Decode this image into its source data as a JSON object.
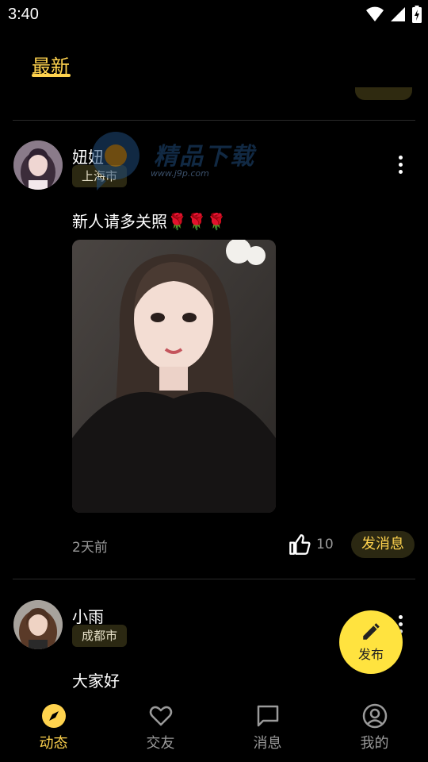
{
  "status_bar": {
    "time": "3:40"
  },
  "top_tabs": [
    {
      "label": "最新",
      "active": true
    }
  ],
  "posts": [
    {
      "username": "妞妞",
      "city": "上海市",
      "text": "新人请多关照🌹🌹🌹",
      "time": "2天前",
      "likes": "10",
      "message_label": "发消息"
    },
    {
      "username": "小雨",
      "city": "成都市",
      "text": "大家好"
    }
  ],
  "watermark": {
    "main": "精品下载",
    "sub": "www.j9p.com"
  },
  "fab": {
    "label": "发布",
    "icon": "pencil-icon"
  },
  "bottom_nav": [
    {
      "label": "动态",
      "icon": "compass-icon",
      "active": true
    },
    {
      "label": "交友",
      "icon": "heart-icon",
      "active": false
    },
    {
      "label": "消息",
      "icon": "chat-icon",
      "active": false
    },
    {
      "label": "我的",
      "icon": "profile-icon",
      "active": false
    }
  ],
  "colors": {
    "accent": "#ffd34e",
    "background": "#000000",
    "muted": "#9a9a9a",
    "tag_bg": "#2b2812"
  }
}
